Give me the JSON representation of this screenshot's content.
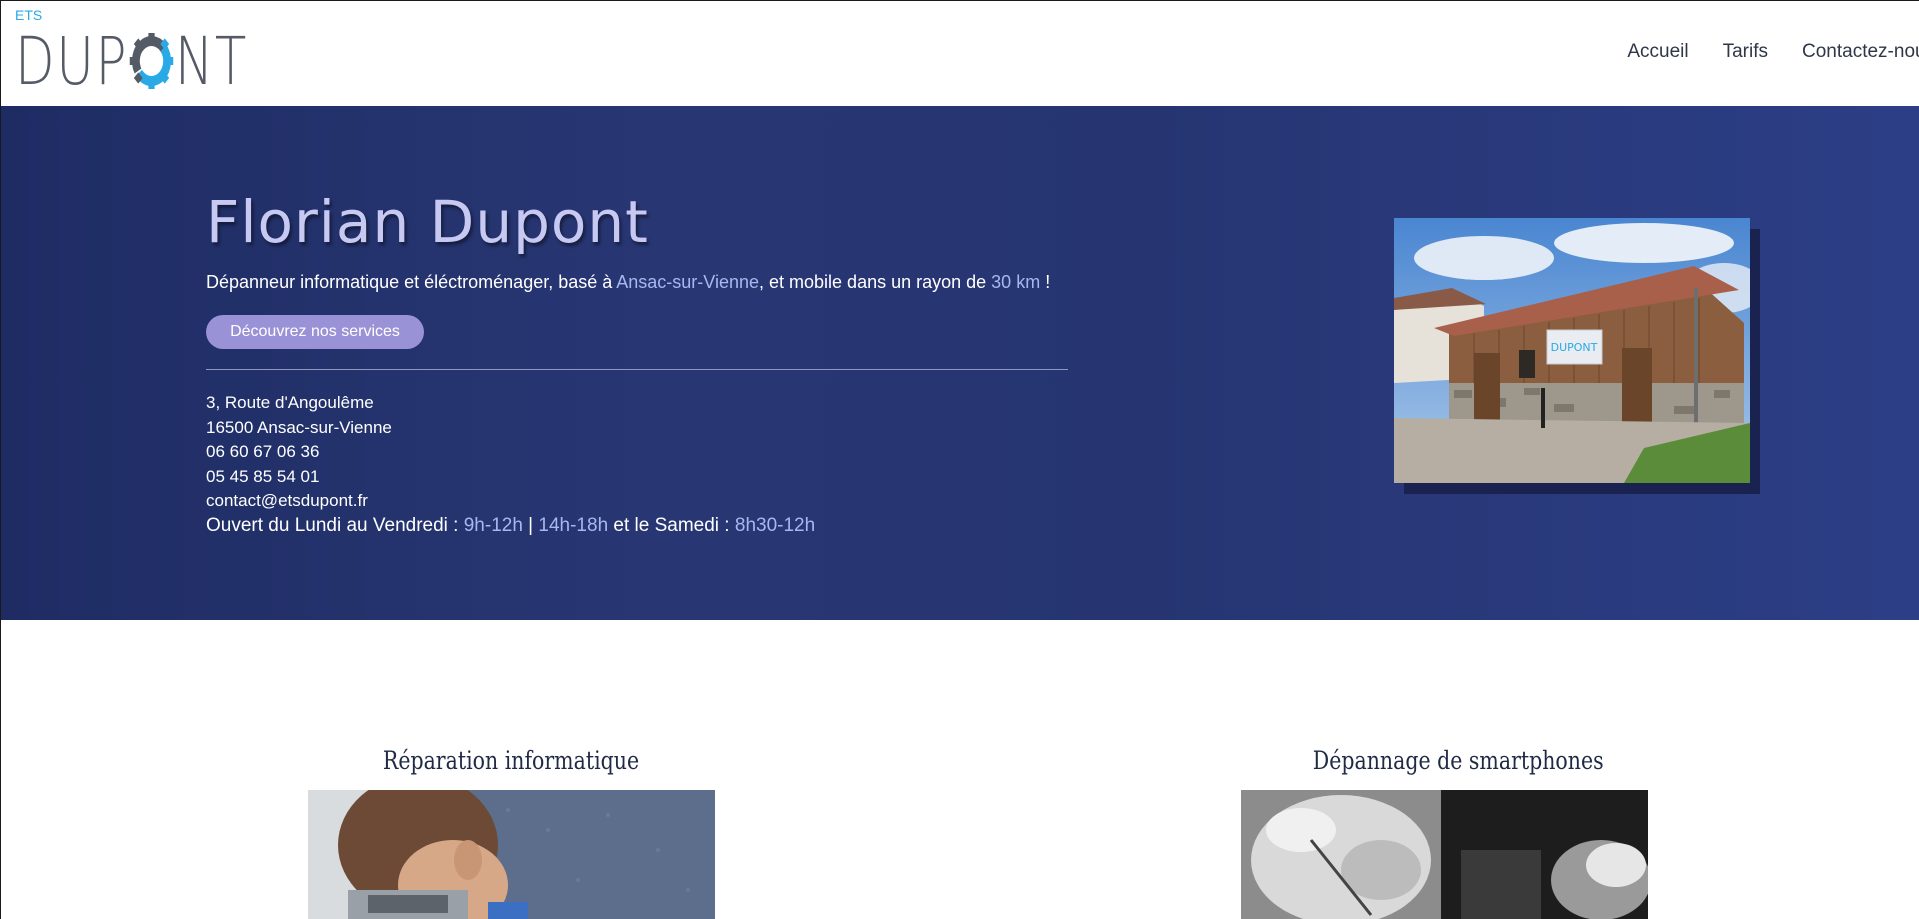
{
  "header": {
    "logo_prefix": "ETS",
    "logo_left": "DUP",
    "logo_right": "NT",
    "nav": [
      "Accueil",
      "Tarifs",
      "Contactez-nous"
    ]
  },
  "hero": {
    "title": "Florian Dupont",
    "desc_1": "Dépanneur informatique et éléctroménager, basé à ",
    "desc_place": "Ansac-sur-Vienne",
    "desc_2": ", et mobile dans un rayon de ",
    "desc_km": "30 km",
    "desc_3": " !",
    "button": "Découvrez nos services",
    "address_1": "3, Route d'Angoulême",
    "address_2": "16500 Ansac-sur-Vienne",
    "phone_1": "06 60 67 06 36",
    "phone_2": "05 45 85 54 01",
    "email": "contact@etsdupont.fr",
    "hours_1": "Ouvert du Lundi au Vendredi : ",
    "hours_am": "9h-12h",
    "hours_sep": " | ",
    "hours_pm": "14h-18h",
    "hours_2": " et le Samedi : ",
    "hours_sat": "8h30-12h",
    "photo_sign": "DUPONT"
  },
  "services": [
    {
      "title": "Réparation informatique"
    },
    {
      "title": "Dépannage de smartphones"
    }
  ],
  "colors": {
    "hero_bg": "#283774",
    "accent_light": "#a9b7f0",
    "button": "#9a92d6",
    "logo_blue": "#29a9e6"
  }
}
